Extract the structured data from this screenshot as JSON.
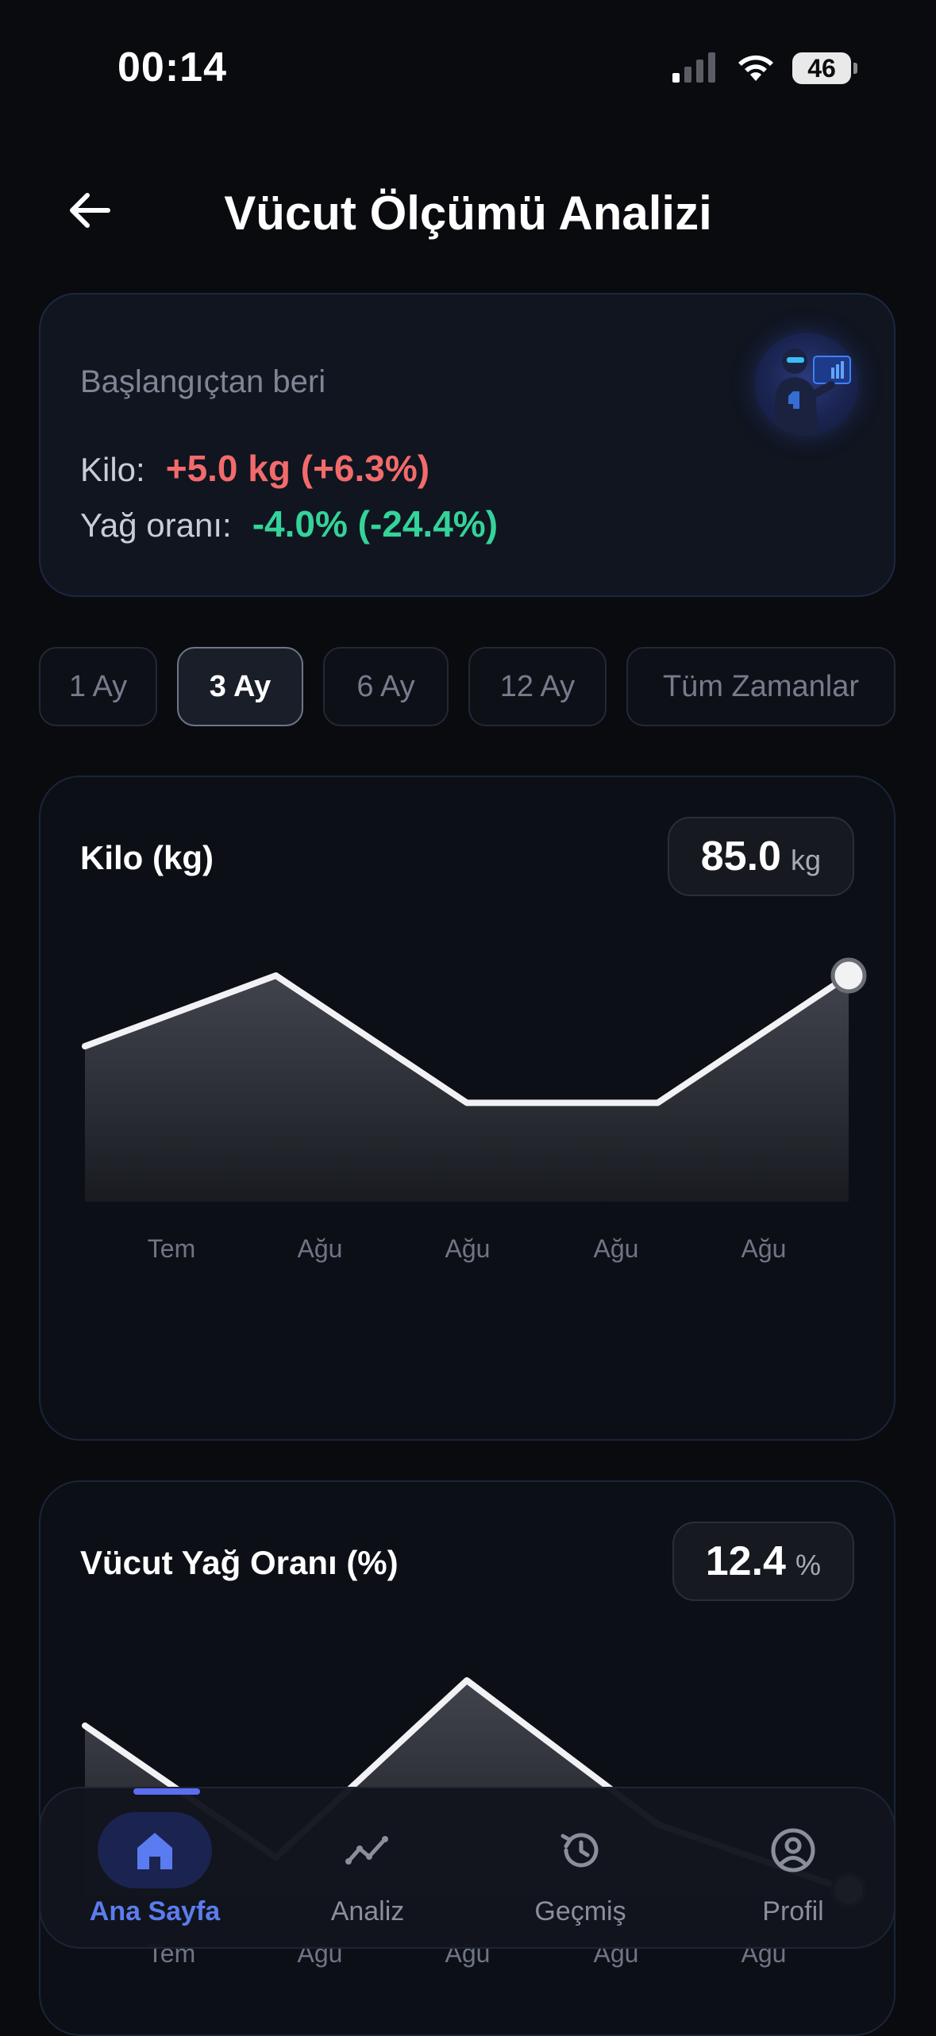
{
  "status_bar": {
    "time": "00:14",
    "battery": "46"
  },
  "header": {
    "title": "Vücut Ölçümü Analizi"
  },
  "summary": {
    "subtitle": "Başlangıçtan beri",
    "weight_label": "Kilo:",
    "weight_change": "+5.0 kg (+6.3%)",
    "fat_label": "Yağ oranı:",
    "fat_change": "-4.0% (-24.4%)",
    "colors": {
      "negative": "#f26b6b",
      "positive": "#34d399"
    }
  },
  "filters": {
    "options": [
      "1 Ay",
      "3 Ay",
      "6 Ay",
      "12 Ay",
      "Tüm Zamanlar"
    ],
    "selected": "3 Ay"
  },
  "charts": {
    "weight": {
      "title": "Kilo (kg)",
      "current_value": "85.0",
      "unit": "kg"
    },
    "fat": {
      "title": "Vücut Yağ Oranı (%)",
      "current_value": "12.4",
      "unit": "%"
    }
  },
  "chart_data": [
    {
      "type": "area",
      "title": "Kilo (kg)",
      "x": [
        "Tem",
        "Ağu",
        "Ağu",
        "Ağu",
        "Ağu"
      ],
      "tick_labels": [
        "Tem",
        "Ağu",
        "Ağu",
        "Ağu",
        "Ağu"
      ],
      "points": [
        82.5,
        85.0,
        80.5,
        80.5,
        85.0
      ],
      "ylim": [
        77.0,
        85.0
      ],
      "grid": false,
      "highlight_last": true
    },
    {
      "type": "area",
      "title": "Vücut Yağ Oranı (%)",
      "x": [
        "Tem",
        "Ağu",
        "Ağu",
        "Ağu",
        "Ağu"
      ],
      "tick_labels": [
        "Tem",
        "Ağu",
        "Ağu",
        "Ağu",
        "Ağu"
      ],
      "points": [
        16.4,
        13.2,
        17.5,
        14.0,
        12.4
      ],
      "ylim": [
        12.0,
        17.5
      ],
      "grid": false,
      "highlight_last": true
    }
  ],
  "bottom_nav": {
    "items": [
      {
        "label": "Ana Sayfa",
        "icon": "home-icon",
        "active": true
      },
      {
        "label": "Analiz",
        "icon": "trend-icon",
        "active": false
      },
      {
        "label": "Geçmiş",
        "icon": "history-icon",
        "active": false
      },
      {
        "label": "Profil",
        "icon": "profile-icon",
        "active": false
      }
    ],
    "accent": "#5b7cf0"
  }
}
